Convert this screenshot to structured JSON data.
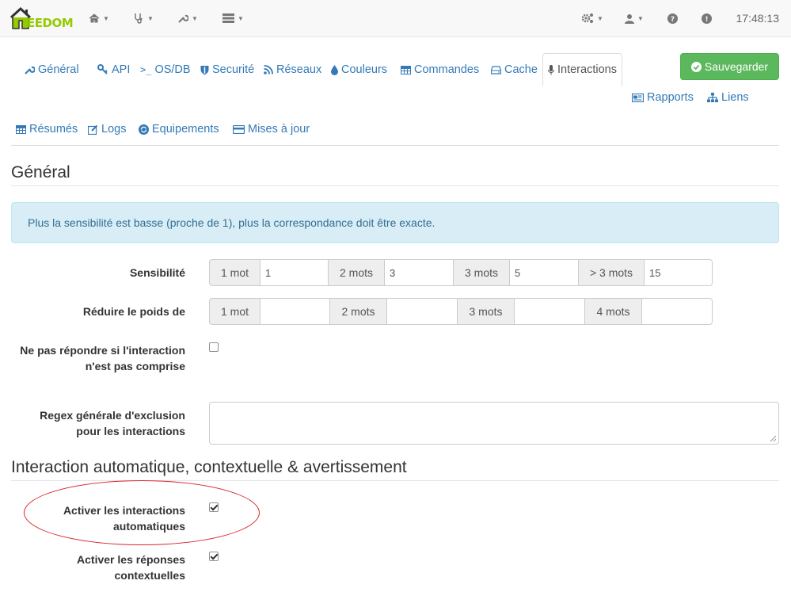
{
  "app": {
    "logo_text": "EEDOM",
    "clock": "17:48:13"
  },
  "navbar": {
    "left_menus": [
      "home-icon",
      "stethoscope-icon",
      "wrench-icon",
      "server-icon"
    ],
    "right_menus": [
      "cogs-icon",
      "user-icon",
      "question-icon",
      "exclamation-icon"
    ]
  },
  "tabs": {
    "general": "Général",
    "api": "API",
    "osdb": "OS/DB",
    "securite": "Securité",
    "reseaux": "Réseaux",
    "couleurs": "Couleurs",
    "commandes": "Commandes",
    "cache": "Cache",
    "interactions": "Interactions",
    "rapports": "Rapports",
    "liens": "Liens",
    "resumes": "Résumés",
    "logs": "Logs",
    "equipements": "Equipements",
    "mises_a_jour": "Mises à jour",
    "active": "interactions"
  },
  "save_button": "Sauvegarder",
  "section_general": {
    "title": "Général",
    "alert": "Plus la sensibilité est basse (proche de 1), plus la correspondance doit être exacte.",
    "sensibilite": {
      "label": "Sensibilité",
      "addons": [
        "1 mot",
        "2 mots",
        "3 mots",
        "> 3 mots"
      ],
      "values": [
        "1",
        "3",
        "5",
        "15"
      ]
    },
    "reduire": {
      "label": "Réduire le poids de",
      "addons": [
        "1 mot",
        "2 mots",
        "3 mots",
        "4 mots"
      ],
      "values": [
        "",
        "",
        "",
        ""
      ]
    },
    "ne_pas_repondre": {
      "label": "Ne pas répondre si l'interaction n'est pas comprise",
      "checked": false
    },
    "regex": {
      "label": "Regex générale d'exclusion pour les interactions",
      "value": ""
    }
  },
  "section_auto": {
    "title": "Interaction automatique, contextuelle & avertissement",
    "activer_auto": {
      "label": "Activer les interactions automatiques",
      "checked": true
    },
    "activer_contextuelles": {
      "label": "Activer les réponses contextuelles",
      "checked": true
    }
  },
  "colors": {
    "link": "#337ab7",
    "save": "#5cb85c",
    "alert_bg": "#d9edf7",
    "alert_text": "#31708f",
    "highlight": "#d9252b",
    "logo_green": "#94ca02"
  }
}
